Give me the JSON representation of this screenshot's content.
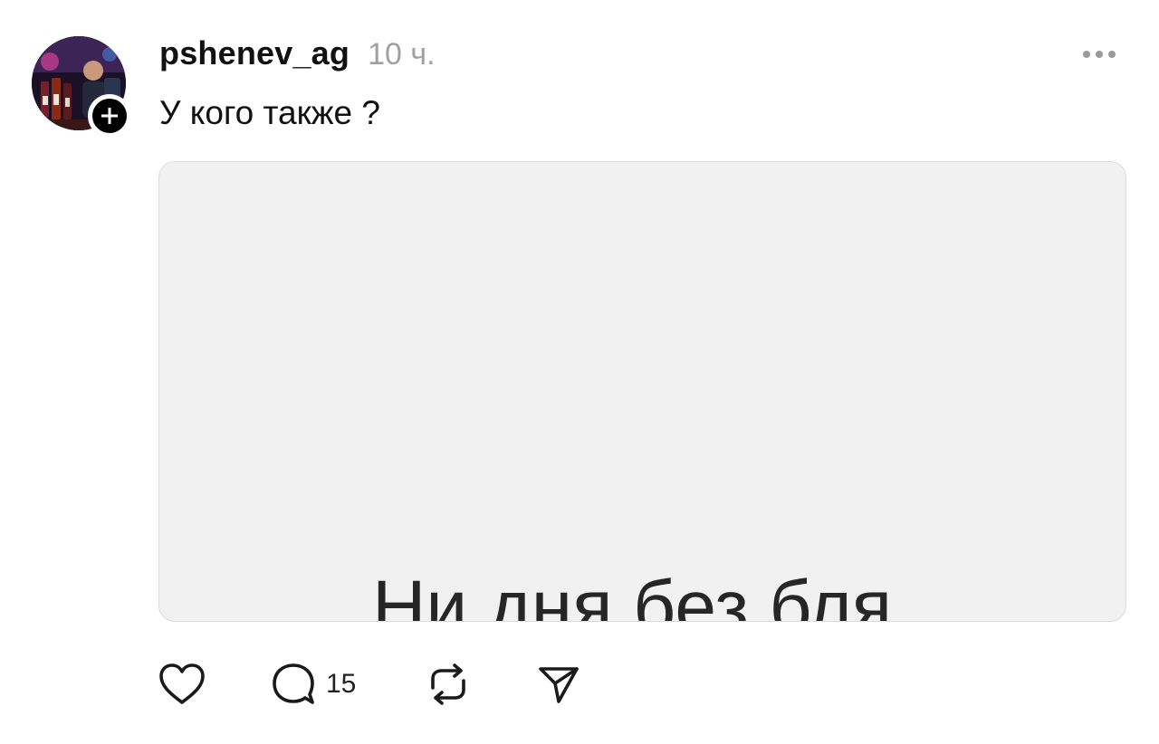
{
  "post": {
    "username": "pshenev_ag",
    "time": "10 ч.",
    "caption": "У кого также ?",
    "media_text": "Ни дня без бля."
  },
  "actions": {
    "like_icon": "heart-icon",
    "comment_icon": "comment-icon",
    "comment_count": "15",
    "repost_icon": "repost-icon",
    "share_icon": "send-icon"
  },
  "icons": {
    "more": "more-icon",
    "follow": "plus-icon"
  },
  "colors": {
    "text": "#111111",
    "muted": "#a0a0a0",
    "media_bg": "#f1f1f1",
    "media_border": "#dcdcdc",
    "badge": "#000000"
  }
}
